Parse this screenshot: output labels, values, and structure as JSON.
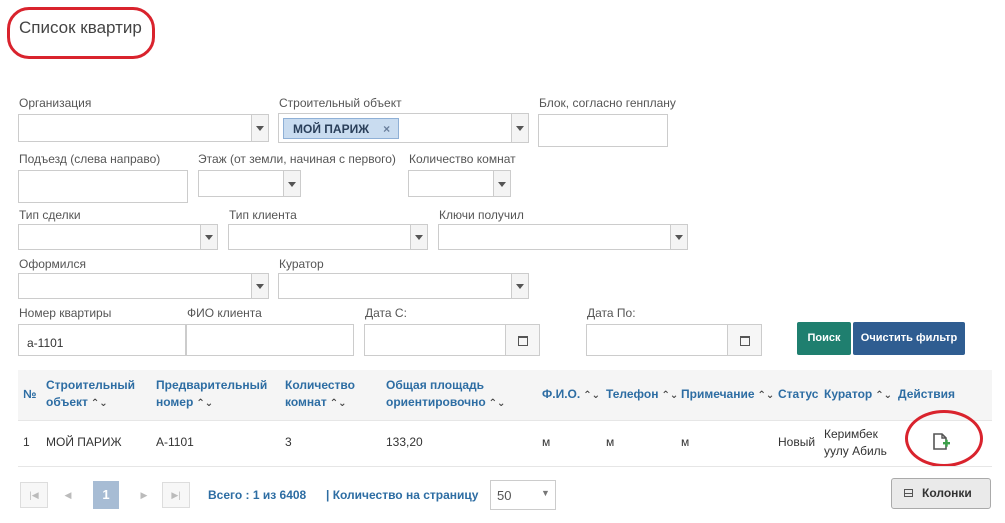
{
  "page": {
    "title": "Список квартир"
  },
  "filters": {
    "organization": {
      "label": "Организация",
      "value": ""
    },
    "building_object": {
      "label": "Строительный объект",
      "selected_tag": "МОЙ ПАРИЖ",
      "remove_symbol": "×"
    },
    "block": {
      "label": "Блок, согласно генплану",
      "value": ""
    },
    "entrance": {
      "label": "Подъезд (слева направо)",
      "value": ""
    },
    "floor": {
      "label": "Этаж (от земли, начиная с первого)",
      "value": ""
    },
    "rooms": {
      "label": "Количество комнат",
      "value": ""
    },
    "deal_type": {
      "label": "Тип сделки",
      "value": ""
    },
    "client_type": {
      "label": "Тип клиента",
      "value": ""
    },
    "keys_received": {
      "label": "Ключи получил",
      "value": ""
    },
    "registered": {
      "label": "Оформился",
      "value": ""
    },
    "curator": {
      "label": "Куратор",
      "value": ""
    },
    "apartment_number": {
      "label": "Номер квартиры",
      "value": "а-1101"
    },
    "client_name": {
      "label": "ФИО клиента",
      "value": ""
    },
    "date_from": {
      "label": "Дата С:",
      "value": ""
    },
    "date_to": {
      "label": "Дата По:",
      "value": ""
    },
    "search_button": "Поиск",
    "clear_button": "Очистить фильтр"
  },
  "table": {
    "columns": {
      "num": "№",
      "object_l1": "Строительный",
      "object_l2": "объект",
      "prelim_l1": "Предварительный",
      "prelim_l2": "номер",
      "rooms_l1": "Количество",
      "rooms_l2": "комнат",
      "area_l1": "Общая площадь",
      "area_l2": "ориентировочно",
      "fio": "Ф.И.О.",
      "phone": "Телефон",
      "note": "Примечание",
      "status": "Статус",
      "curator": "Куратор",
      "actions": "Действия"
    },
    "sort_icon": "⌃⌄",
    "rows": [
      {
        "num": "1",
        "object": "МОЙ ПАРИЖ",
        "prelim_number": "А-1101",
        "rooms": "3",
        "area": "133,20",
        "fio": "м",
        "phone": "м",
        "note": "м",
        "status": "Новый",
        "curator_l1": "Керимбек",
        "curator_l2": "уулу Абиль",
        "action_icon": "add-document-icon"
      }
    ]
  },
  "pagination": {
    "current_page": "1",
    "summary": "Всего : 1 из 6408",
    "per_page_label": "| Количество на страницу",
    "per_page_value": "50",
    "columns_button": "Колонки"
  },
  "colors": {
    "search_button": "#1f7f6f",
    "clear_button": "#2f5d91",
    "header_text": "#2d6da3",
    "annotation_ring": "#d9232d"
  }
}
